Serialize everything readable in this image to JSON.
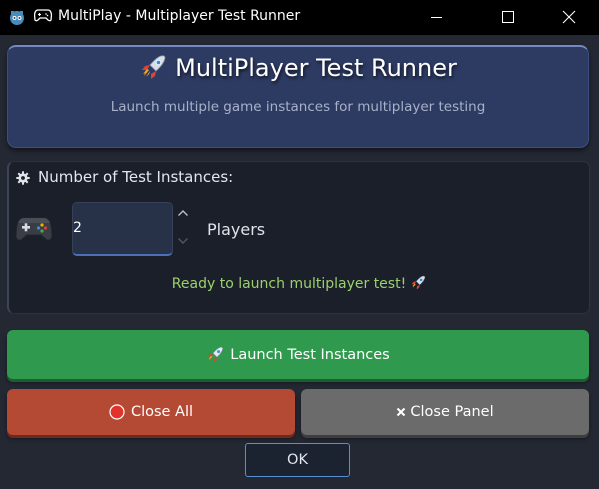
{
  "window": {
    "title": "MultiPlay - Multiplayer Test Runner",
    "app_icon": "godot-icon",
    "title_icon": "gamepad-icon",
    "controls": [
      "minimize-icon",
      "maximize-icon",
      "close-icon"
    ]
  },
  "header": {
    "icon": "rocket-icon",
    "title": "MultiPlayer Test Runner",
    "subtitle": "Launch multiple game instances for multiplayer testing"
  },
  "instances": {
    "label_icon": "gear-icon",
    "label": "Number of Test Instances:",
    "controller_icon": "gamepad-icon",
    "count_value": "2",
    "unit_label": "Players",
    "status": "Ready to launch multiplayer test!",
    "status_icon": "rocket-icon"
  },
  "buttons": {
    "launch": {
      "label": "Launch Test Instances",
      "icon": "rocket-icon"
    },
    "close_all": {
      "label": "Close All",
      "icon": "red-circle-icon"
    },
    "close_panel": {
      "label": "Close Panel",
      "icon": "x-mark-icon"
    },
    "ok": {
      "label": "OK"
    }
  },
  "colors": {
    "window_bg": "#232833",
    "header_bg": "#2d3b63",
    "status_text": "#9bd16e",
    "launch_bg": "#2f9a4d",
    "close_all_bg": "#b44a34",
    "close_panel_bg": "#6b6b6b",
    "focus_border": "#5a8fcf"
  }
}
